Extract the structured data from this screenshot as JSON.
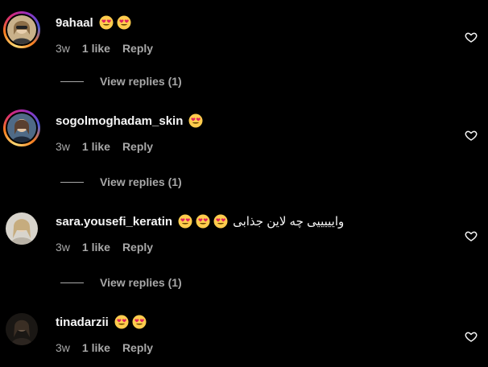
{
  "comments": [
    {
      "username": "9ahaal",
      "emoji_count": 2,
      "text": "",
      "time": "3w",
      "likes": "1 like",
      "reply": "Reply",
      "view_replies": "View replies (1)",
      "avatar_ring": true,
      "avatar_tone": "#b89b6a"
    },
    {
      "username": "sogolmoghadam_skin",
      "emoji_count": 1,
      "text": "",
      "time": "3w",
      "likes": "1 like",
      "reply": "Reply",
      "view_replies": "View replies (1)",
      "avatar_ring": true,
      "avatar_tone": "#6f7f8f"
    },
    {
      "username": "sara.yousefi_keratin",
      "emoji_count": 3,
      "text": "وایییییی چه لاین جذابی",
      "time": "3w",
      "likes": "1 like",
      "reply": "Reply",
      "view_replies": "View replies (1)",
      "avatar_ring": false,
      "avatar_tone": "#cfcac0"
    },
    {
      "username": "tinadarzii",
      "emoji_count": 2,
      "text": "",
      "time": "3w",
      "likes": "1 like",
      "reply": "Reply",
      "view_replies": "",
      "avatar_ring": false,
      "avatar_tone": "#2a2622"
    }
  ],
  "icons": {
    "emoji": "smiling-face-with-heart-eyes-icon",
    "like": "heart-outline-icon"
  },
  "colors": {
    "background": "#000000",
    "primary_text": "#f5f5f5",
    "secondary_text": "#a8a8a8"
  }
}
